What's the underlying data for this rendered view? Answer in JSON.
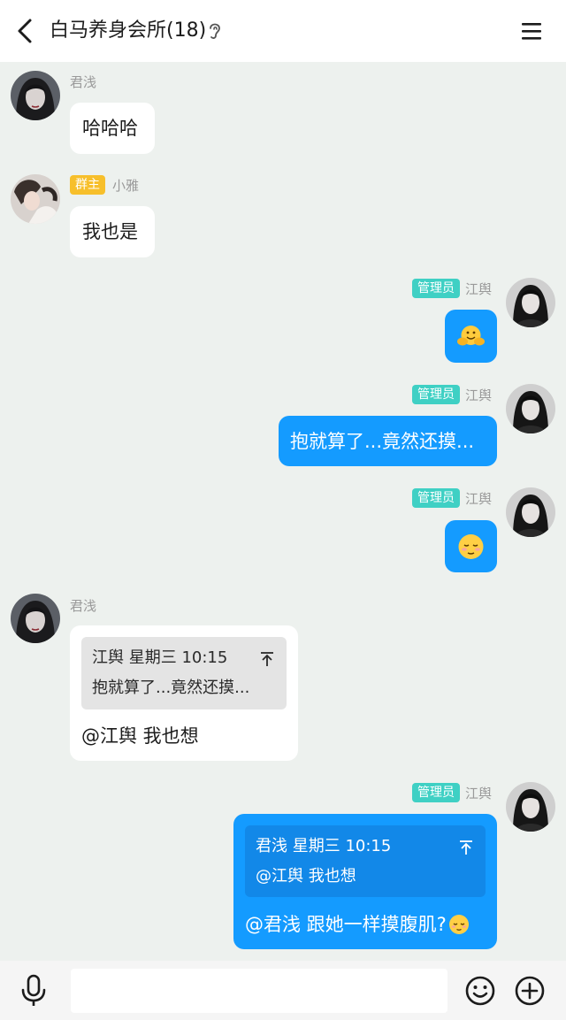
{
  "header": {
    "title": "白马养身会所(18)"
  },
  "messages": [
    {
      "sender": "君浅",
      "text": "哈哈哈"
    },
    {
      "sender": "小雅",
      "role": "群主",
      "text": "我也是"
    },
    {
      "sender": "江舆",
      "role": "管理员",
      "sticker": "hugging-emoji"
    },
    {
      "sender": "江舆",
      "role": "管理员",
      "text": "抱就算了...竟然还摸..."
    },
    {
      "sender": "江舆",
      "role": "管理员",
      "sticker": "relieved-emoji"
    },
    {
      "sender": "君浅",
      "quote": {
        "meta": "江舆 星期三 10:15",
        "text": "抱就算了...竟然还摸..."
      },
      "text": "@江舆 我也想"
    },
    {
      "sender": "江舆",
      "role": "管理员",
      "quote": {
        "meta": "君浅 星期三 10:15",
        "text": "@江舆 我也想"
      },
      "text": "@君浅 跟她一样摸腹肌?"
    }
  ],
  "colors": {
    "accent": "#149bff",
    "owner_badge": "#f7bf2b",
    "admin_badge": "#3fd0c4",
    "background": "#edf1ee"
  },
  "bottom_bar": {
    "input_value": ""
  }
}
